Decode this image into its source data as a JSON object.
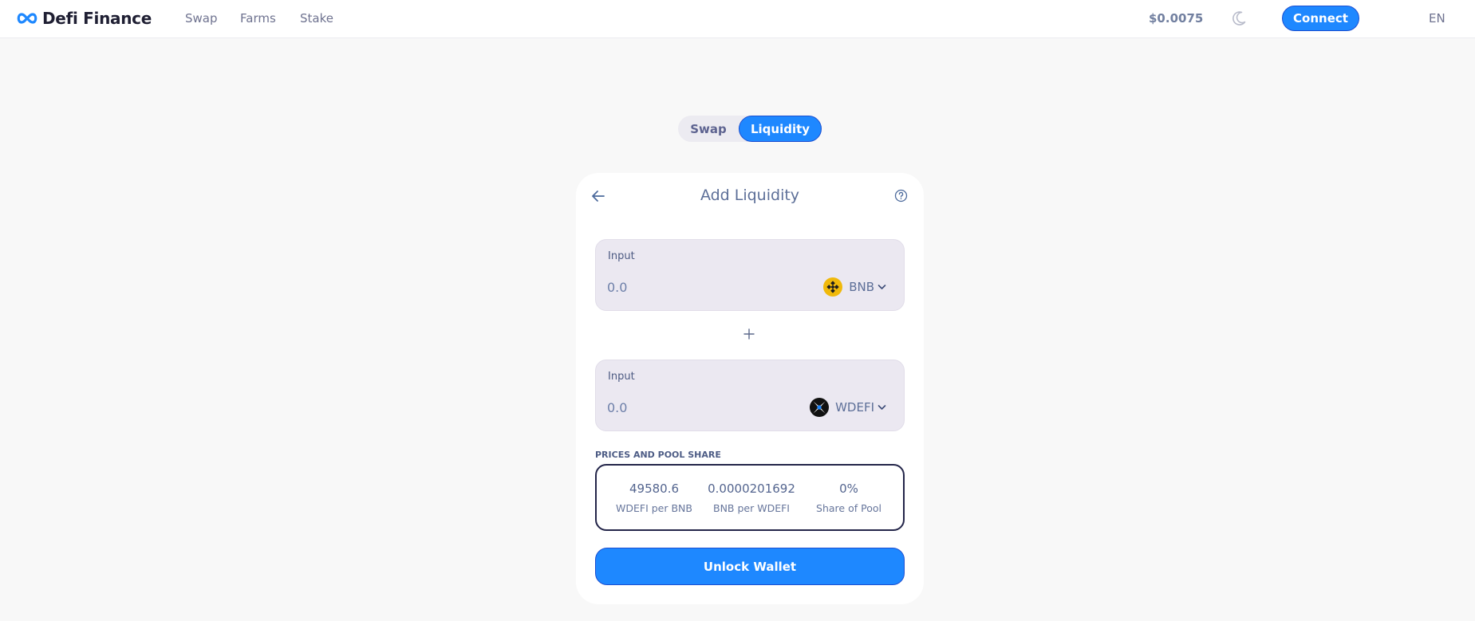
{
  "header": {
    "brand": "Defi Finance",
    "nav": [
      {
        "label": "Swap"
      },
      {
        "label": "Farms"
      },
      {
        "label": "Stake"
      }
    ],
    "token_price": "$0.0075",
    "theme_icon": "moon-icon",
    "connect_label": "Connect",
    "language": "EN"
  },
  "toggle": {
    "swap_label": "Swap",
    "liquidity_label": "Liquidity",
    "active": "Liquidity"
  },
  "card": {
    "title": "Add Liquidity",
    "back_icon": "arrow-left-icon",
    "help_icon": "question-circle-icon",
    "inputs": [
      {
        "label": "Input",
        "placeholder": "0.0",
        "token": "BNB",
        "token_icon": "bnb-icon"
      },
      {
        "label": "Input",
        "placeholder": "0.0",
        "token": "WDEFI",
        "token_icon": "wdefi-icon"
      }
    ],
    "plus_icon": "plus-icon",
    "prices": {
      "section_label": "PRICES AND POOL SHARE",
      "items": [
        {
          "value": "49580.6",
          "label": "WDEFI per BNB"
        },
        {
          "value": "0.0000201692",
          "label": "BNB per WDEFI"
        },
        {
          "value": "0%",
          "label": "Share of Pool"
        }
      ]
    },
    "unlock_label": "Unlock Wallet"
  },
  "colors": {
    "accent": "#1e88ff",
    "accent_border": "#1b4fd1",
    "input_bg": "#ebe8f1",
    "page_bg": "#f8f8f8",
    "bnb_yellow": "#f0b90b"
  }
}
